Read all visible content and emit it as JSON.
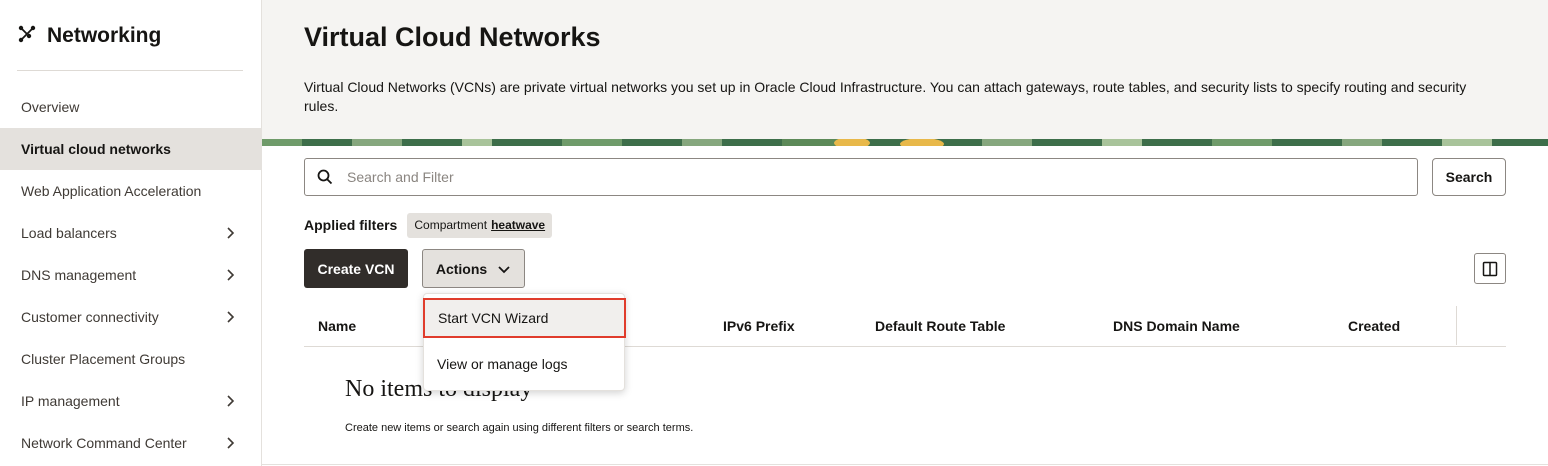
{
  "sidebar": {
    "title": "Networking",
    "items": [
      {
        "label": "Overview",
        "has_submenu": false,
        "active": false
      },
      {
        "label": "Virtual cloud networks",
        "has_submenu": false,
        "active": true
      },
      {
        "label": "Web Application Acceleration",
        "has_submenu": false,
        "active": false
      },
      {
        "label": "Load balancers",
        "has_submenu": true,
        "active": false
      },
      {
        "label": "DNS management",
        "has_submenu": true,
        "active": false
      },
      {
        "label": "Customer connectivity",
        "has_submenu": true,
        "active": false
      },
      {
        "label": "Cluster Placement Groups",
        "has_submenu": false,
        "active": false
      },
      {
        "label": "IP management",
        "has_submenu": true,
        "active": false
      },
      {
        "label": "Network Command Center",
        "has_submenu": true,
        "active": false
      }
    ]
  },
  "header": {
    "title": "Virtual Cloud Networks",
    "description": "Virtual Cloud Networks (VCNs) are private virtual networks you set up in Oracle Cloud Infrastructure. You can attach gateways, route tables, and security lists to specify routing and security rules."
  },
  "search": {
    "placeholder": "Search and Filter",
    "value": "",
    "button_label": "Search"
  },
  "filters": {
    "label": "Applied filters",
    "chips": [
      {
        "key": "Compartment",
        "value": "heatwave"
      }
    ]
  },
  "toolbar": {
    "create_label": "Create VCN",
    "actions_label": "Actions"
  },
  "table": {
    "columns": [
      "Name",
      "IPv6 Prefix",
      "Default Route Table",
      "DNS Domain Name",
      "Created"
    ],
    "empty_title": "No items to display",
    "empty_subtitle": "Create new items or search again using different filters or search terms."
  },
  "actions_menu": {
    "items": [
      "Start VCN Wizard",
      "View or manage logs"
    ],
    "highlighted_index": 0
  },
  "colors": {
    "primary_button": "#312d2a",
    "active_nav_bg": "#e4e1dd",
    "highlight_border": "#e03c2c",
    "header_bg": "#f5f4f2"
  },
  "icons": {
    "header": "network-nodes-icon",
    "search": "search-icon",
    "actions": "chevron-down-icon",
    "submenu": "chevron-right-icon",
    "columns": "columns-icon"
  }
}
